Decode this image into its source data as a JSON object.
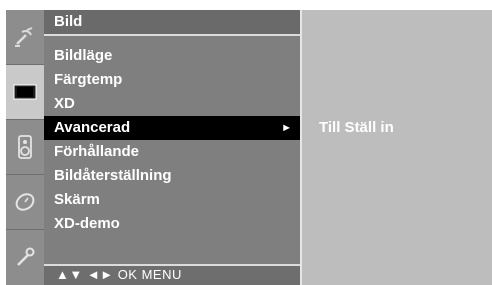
{
  "icons": [
    "satellite-dish-icon",
    "picture-icon",
    "speaker-icon",
    "clock-icon",
    "wrench-icon"
  ],
  "menu": {
    "title": "Bild",
    "items": [
      {
        "label": "Bildläge"
      },
      {
        "label": "Färgtemp"
      },
      {
        "label": "XD"
      },
      {
        "label": "Avancerad",
        "selected": true
      },
      {
        "label": "Förhållande"
      },
      {
        "label": "Bildåterställning"
      },
      {
        "label": "Skärm"
      },
      {
        "label": "XD-demo"
      }
    ],
    "submenu_arrow": "►",
    "footer_hint": "▲▼  ◄►  OK  MENU"
  },
  "submenu": {
    "text": "Till Ställ in"
  },
  "colors": {
    "panel": "#7f7f7f",
    "highlight": "#000000",
    "submenu_panel": "#bdbdbd"
  }
}
